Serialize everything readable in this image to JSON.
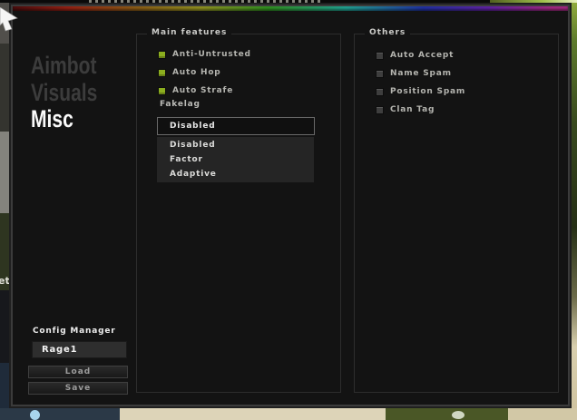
{
  "background": {
    "edge_text_fragment": "et"
  },
  "window": {
    "sidebar": {
      "tabs": [
        {
          "label": "Aimbot",
          "active": false
        },
        {
          "label": "Visuals",
          "active": false
        },
        {
          "label": "Misc",
          "active": true
        }
      ]
    },
    "main_features": {
      "title": "Main features",
      "checkboxes": [
        {
          "label": "Anti-Untrusted",
          "checked": true
        },
        {
          "label": "Auto Hop",
          "checked": true
        },
        {
          "label": "Auto Strafe",
          "checked": true
        }
      ],
      "fakelag": {
        "label": "Fakelag",
        "selected": "Disabled",
        "options": [
          "Disabled",
          "Factor",
          "Adaptive"
        ]
      }
    },
    "others": {
      "title": "Others",
      "checkboxes": [
        {
          "label": "Auto Accept",
          "checked": false
        },
        {
          "label": "Name Spam",
          "checked": false
        },
        {
          "label": "Position Spam",
          "checked": false
        },
        {
          "label": "Clan Tag",
          "checked": false
        }
      ]
    },
    "config_manager": {
      "title": "Config Manager",
      "config_value": "Rage1",
      "load_label": "Load",
      "save_label": "Save"
    }
  },
  "colors": {
    "window_bg": "#131313",
    "checkbox_checked": "#8cae1f",
    "checkbox_unchecked": "#3e3e3e",
    "active_tab": "#fafafa",
    "inactive_tab": "#3c3c3c",
    "rainbow_bar": [
      "#4a0d0d",
      "#932013",
      "#8a5a15",
      "#8f8f1f",
      "#2f8f1f",
      "#1f9f8f",
      "#2030a0",
      "#6020a0",
      "#a02880"
    ]
  }
}
